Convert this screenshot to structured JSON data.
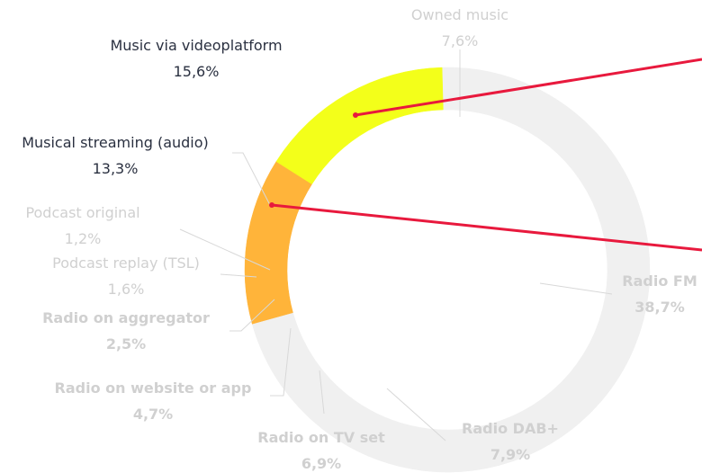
{
  "chart_data": {
    "type": "pie",
    "variant": "donut",
    "title": "",
    "slices": [
      {
        "id": "owned",
        "label": "Owned music",
        "value_text": "7,6%",
        "value": 7.6,
        "color": "#f0f0f0",
        "label_color": "#d0d0d0",
        "bold": false
      },
      {
        "id": "radio-fm",
        "label": "Radio FM",
        "value_text": "38,7%",
        "value": 38.7,
        "color": "#f0f0f0",
        "label_color": "#d0d0d0",
        "bold": true
      },
      {
        "id": "radio-dab",
        "label": "Radio DAB+",
        "value_text": "7,9%",
        "value": 7.9,
        "color": "#f0f0f0",
        "label_color": "#d0d0d0",
        "bold": true
      },
      {
        "id": "radio-tv",
        "label": "Radio on TV set",
        "value_text": "6,9%",
        "value": 6.9,
        "color": "#f0f0f0",
        "label_color": "#d0d0d0",
        "bold": true
      },
      {
        "id": "radio-web",
        "label": "Radio on website or app",
        "value_text": "4,7%",
        "value": 4.7,
        "color": "#f0f0f0",
        "label_color": "#d0d0d0",
        "bold": true
      },
      {
        "id": "radio-agg",
        "label": "Radio on aggregator",
        "value_text": "2,5%",
        "value": 2.5,
        "color": "#f0f0f0",
        "label_color": "#d0d0d0",
        "bold": true
      },
      {
        "id": "podcast-replay",
        "label": "Podcast replay (TSL)",
        "value_text": "1,6%",
        "value": 1.6,
        "color": "#f0f0f0",
        "label_color": "#d0d0d0",
        "bold": false
      },
      {
        "id": "podcast-orig",
        "label": "Podcast original",
        "value_text": "1,2%",
        "value": 1.2,
        "color": "#f0f0f0",
        "label_color": "#d0d0d0",
        "bold": false
      },
      {
        "id": "music-stream",
        "label": "Musical streaming (audio)",
        "value_text": "13,3%",
        "value": 13.3,
        "color": "#ffb43a",
        "label_color": "#2a3040",
        "bold": false
      },
      {
        "id": "music-video",
        "label": "Music via videoplatform",
        "value_text": "15,6%",
        "value": 15.6,
        "color": "#f3ff1a",
        "label_color": "#2a3040",
        "bold": false
      }
    ],
    "highlight_lines_color": "#e8193d",
    "legend": "none"
  }
}
